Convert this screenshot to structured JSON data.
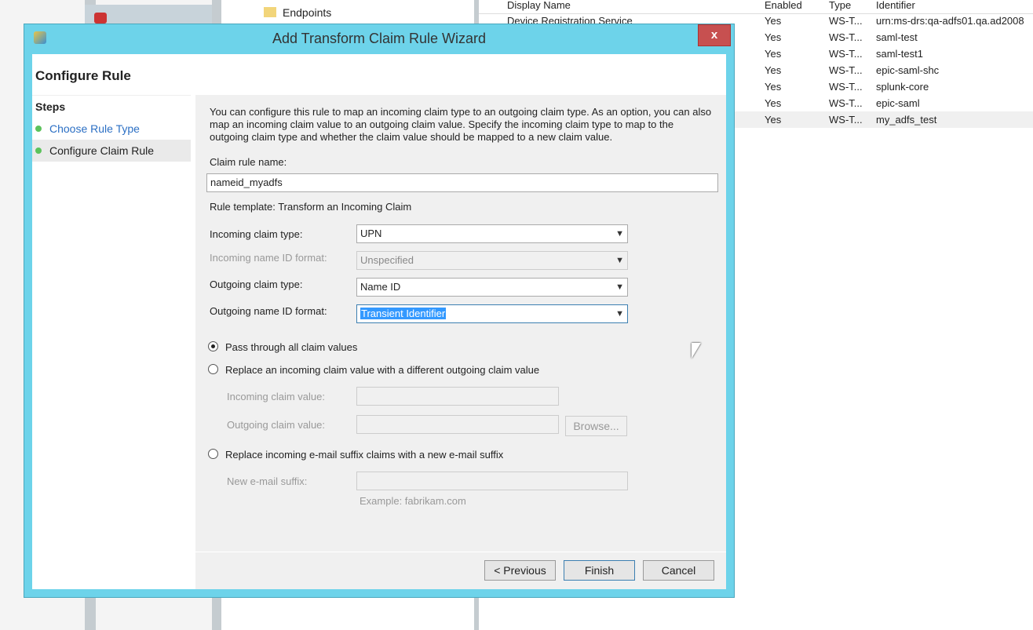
{
  "background": {
    "tree_item": "Endpoints",
    "list": {
      "columns": [
        "Display Name",
        "Enabled",
        "Type",
        "Identifier"
      ],
      "rows": [
        [
          "Device Registration Service",
          "Yes",
          "WS-T...",
          "urn:ms-drs:qa-adfs01.qa.ad2008"
        ],
        [
          "",
          "Yes",
          "WS-T...",
          "saml-test"
        ],
        [
          "",
          "Yes",
          "WS-T...",
          "saml-test1"
        ],
        [
          "",
          "Yes",
          "WS-T...",
          "epic-saml-shc"
        ],
        [
          "",
          "Yes",
          "WS-T...",
          "splunk-core"
        ],
        [
          "",
          "Yes",
          "WS-T...",
          "epic-saml"
        ],
        [
          "",
          "Yes",
          "WS-T...",
          "my_adfs_test"
        ]
      ]
    }
  },
  "dialog": {
    "title": "Add Transform Claim Rule Wizard",
    "close": "x",
    "header": "Configure Rule",
    "steps_title": "Steps",
    "steps": [
      "Choose Rule Type",
      "Configure Claim Rule"
    ],
    "description": "You can configure this rule to map an incoming claim type to an outgoing claim type. As an option, you can also map an incoming claim value to an outgoing claim value. Specify the incoming claim type to map to the outgoing claim type and whether the claim value should be mapped to a new claim value.",
    "rule_name_label": "Claim rule name:",
    "rule_name": "nameid_myadfs",
    "template": "Rule template: Transform an Incoming Claim",
    "incoming_type_label": "Incoming claim type:",
    "incoming_type": "UPN",
    "incoming_format_label": "Incoming name ID format:",
    "incoming_format": "Unspecified",
    "outgoing_type_label": "Outgoing claim type:",
    "outgoing_type": "Name ID",
    "outgoing_format_label": "Outgoing name ID format:",
    "outgoing_format": "Transient Identifier",
    "radio_pass": "Pass through all claim values",
    "radio_replace": "Replace an incoming claim value with a different outgoing claim value",
    "incoming_value_label": "Incoming claim value:",
    "outgoing_value_label": "Outgoing claim value:",
    "browse": "Browse...",
    "radio_email": "Replace incoming e-mail suffix claims with a new e-mail suffix",
    "email_label": "New e-mail suffix:",
    "email_example": "Example: fabrikam.com",
    "previous": "< Previous",
    "finish": "Finish",
    "cancel": "Cancel"
  }
}
